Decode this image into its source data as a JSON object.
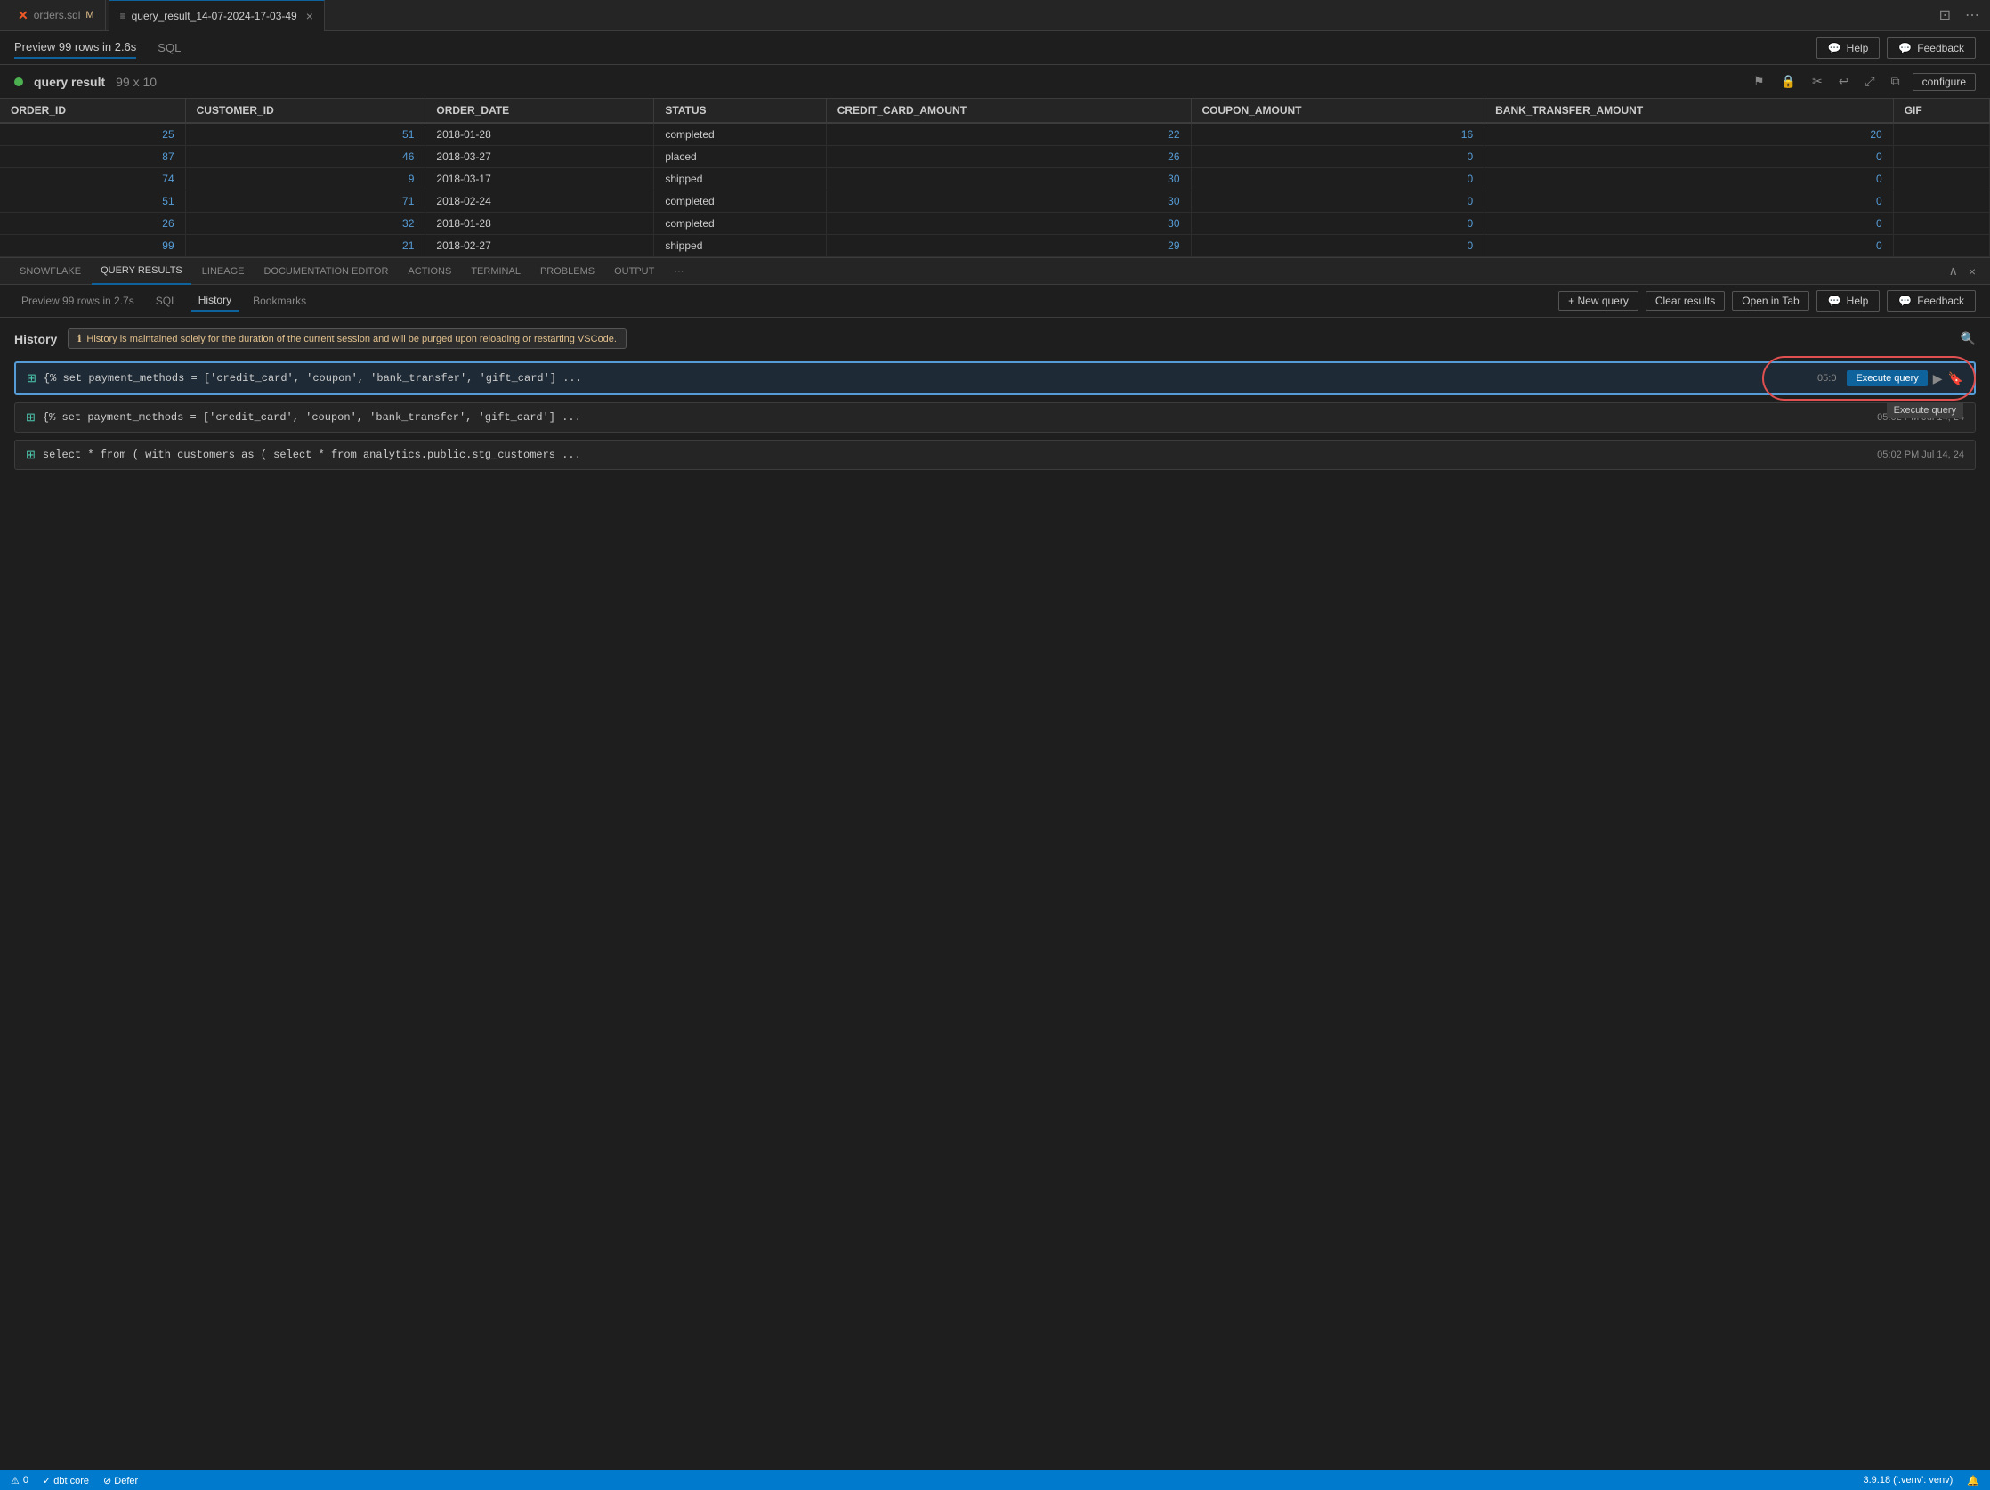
{
  "tabs": [
    {
      "id": "orders",
      "label": "orders.sql",
      "modified": "M",
      "active": false,
      "icon": "dbt"
    },
    {
      "id": "query_result",
      "label": "query_result_14-07-2024-17-03-49",
      "active": true,
      "closable": true
    }
  ],
  "top_panel": {
    "preview_label": "Preview 99 rows in 2.6s",
    "sql_label": "SQL",
    "help_btn": "Help",
    "feedback_btn": "Feedback"
  },
  "result_header": {
    "title": "query result",
    "dims": "99 x 10",
    "configure_label": "configure"
  },
  "table": {
    "columns": [
      "ORDER_ID",
      "CUSTOMER_ID",
      "ORDER_DATE",
      "STATUS",
      "CREDIT_CARD_AMOUNT",
      "COUPON_AMOUNT",
      "BANK_TRANSFER_AMOUNT",
      "GIF"
    ],
    "rows": [
      {
        "order_id": "25",
        "customer_id": "51",
        "order_date": "2018-01-28",
        "status": "completed",
        "credit_card": "22",
        "coupon": "16",
        "bank_transfer": "20",
        "gif": ""
      },
      {
        "order_id": "87",
        "customer_id": "46",
        "order_date": "2018-03-27",
        "status": "placed",
        "credit_card": "26",
        "coupon": "0",
        "bank_transfer": "0",
        "gif": ""
      },
      {
        "order_id": "74",
        "customer_id": "9",
        "order_date": "2018-03-17",
        "status": "shipped",
        "credit_card": "30",
        "coupon": "0",
        "bank_transfer": "0",
        "gif": ""
      },
      {
        "order_id": "51",
        "customer_id": "71",
        "order_date": "2018-02-24",
        "status": "completed",
        "credit_card": "30",
        "coupon": "0",
        "bank_transfer": "0",
        "gif": ""
      },
      {
        "order_id": "26",
        "customer_id": "32",
        "order_date": "2018-01-28",
        "status": "completed",
        "credit_card": "30",
        "coupon": "0",
        "bank_transfer": "0",
        "gif": ""
      },
      {
        "order_id": "99",
        "customer_id": "21",
        "order_date": "2018-02-27",
        "status": "shipped",
        "credit_card": "29",
        "coupon": "0",
        "bank_transfer": "0",
        "gif": ""
      }
    ]
  },
  "bottom_panel": {
    "tabs": [
      "SNOWFLAKE",
      "QUERY RESULTS",
      "LINEAGE",
      "DOCUMENTATION EDITOR",
      "ACTIONS",
      "TERMINAL",
      "PROBLEMS",
      "OUTPUT",
      "..."
    ],
    "active_tab": "QUERY RESULTS",
    "sub_tabs": [
      "Preview 99 rows in 2.7s",
      "SQL",
      "History",
      "Bookmarks"
    ],
    "active_sub_tab": "History",
    "new_query_btn": "+ New query",
    "clear_results_btn": "Clear results",
    "open_in_tab_btn": "Open in Tab",
    "help_btn": "Help",
    "feedback_btn": "Feedback"
  },
  "history": {
    "title": "History",
    "notice": "History is maintained solely for the duration of the current session and will be purged upon reloading or restarting VSCode.",
    "search_icon": "🔍",
    "items": [
      {
        "id": "h1",
        "text": "{% set payment_methods = ['credit_card', 'coupon', 'bank_transfer', 'gift_card'] ...",
        "time": "05:0",
        "execute_label": "Execute query",
        "highlighted": true,
        "tooltip": "Execute query"
      },
      {
        "id": "h2",
        "text": "{% set payment_methods = ['credit_card', 'coupon', 'bank_transfer', 'gift_card'] ...",
        "time": "05:02 PM Jul 14, 24",
        "highlighted": false
      },
      {
        "id": "h3",
        "text": "select * from ( with customers as ( select * from analytics.public.stg_customers ...",
        "time": "05:02 PM Jul 14, 24",
        "highlighted": false
      }
    ]
  },
  "status_bar": {
    "errors": "0",
    "dbt_label": "✓ dbt core",
    "defer_label": "⊘ Defer",
    "version": "3.9.18 ('.venv': venv)",
    "bell_icon": "🔔"
  }
}
